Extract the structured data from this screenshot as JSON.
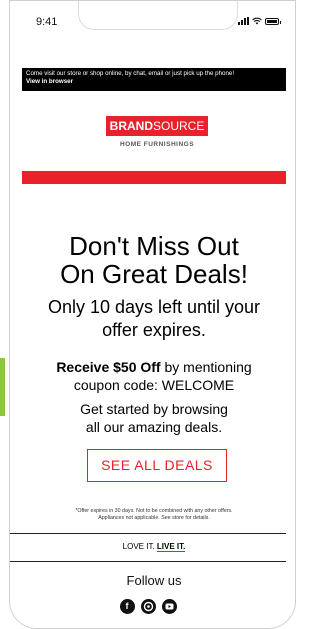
{
  "status_bar": {
    "time": "9:41"
  },
  "preheader": {
    "text": "Come visit our store or shop online, by chat, email or just pick up the phone!",
    "link": "View in browser"
  },
  "logo": {
    "brand_bold": "BRAND",
    "brand_rest": "SOURCE",
    "subtitle": "HOME FURNISHINGS"
  },
  "colors": {
    "brand_red": "#e8212b",
    "accent_green": "#8cc63f"
  },
  "hero": {
    "headline_line1": "Don't Miss Out",
    "headline_line2": "On Great Deals!",
    "subheadline_line1": "Only 10 days left until your",
    "subheadline_line2": "offer expires."
  },
  "offer": {
    "bold": "Receive $50 Off",
    "rest": " by mentioning",
    "line2": "coupon code: WELCOME",
    "browse_line1": "Get started by browsing",
    "browse_line2": "all our amazing deals."
  },
  "cta": {
    "label": "SEE ALL DEALS"
  },
  "disclaimer": {
    "line1": "*Offer expires in 30 days. Not to be combined with any other offers.",
    "line2": "Appliances not applicable. See store for details."
  },
  "tagline": {
    "part1": "LOVE IT. ",
    "part2": "LIVE IT."
  },
  "follow": {
    "title": "Follow us"
  },
  "social": [
    {
      "icon": "facebook-icon",
      "glyph": "f"
    },
    {
      "icon": "pinterest-icon",
      "glyph": "⓪"
    },
    {
      "icon": "youtube-icon",
      "glyph": "▶"
    }
  ]
}
